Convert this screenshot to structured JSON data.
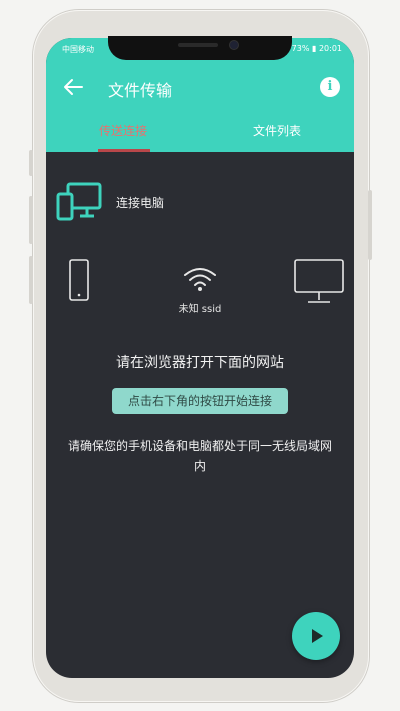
{
  "status": {
    "carrier": "中国移动",
    "battery": "73%",
    "time": "20:01"
  },
  "appbar": {
    "title": "文件传输"
  },
  "tabs": [
    {
      "label": "传送连接"
    },
    {
      "label": "文件列表"
    }
  ],
  "connect": {
    "label": "连接电脑"
  },
  "network": {
    "ssid_label": "未知 ssid"
  },
  "instructions": {
    "prompt": "请在浏览器打开下面的网站",
    "hint_button": "点击右下角的按钮开始连接",
    "note": "请确保您的手机设备和电脑都处于同一无线局域网内"
  },
  "icons": {
    "back": "arrow-left-icon",
    "info": "info-icon",
    "connect": "phone-monitor-icon",
    "phone": "smartphone-icon",
    "wifi": "wifi-icon",
    "computer": "monitor-icon",
    "fab": "play-icon"
  },
  "colors": {
    "accent": "#3ed3bd",
    "background": "#2b2d33",
    "active_tab": "#e7726f"
  }
}
